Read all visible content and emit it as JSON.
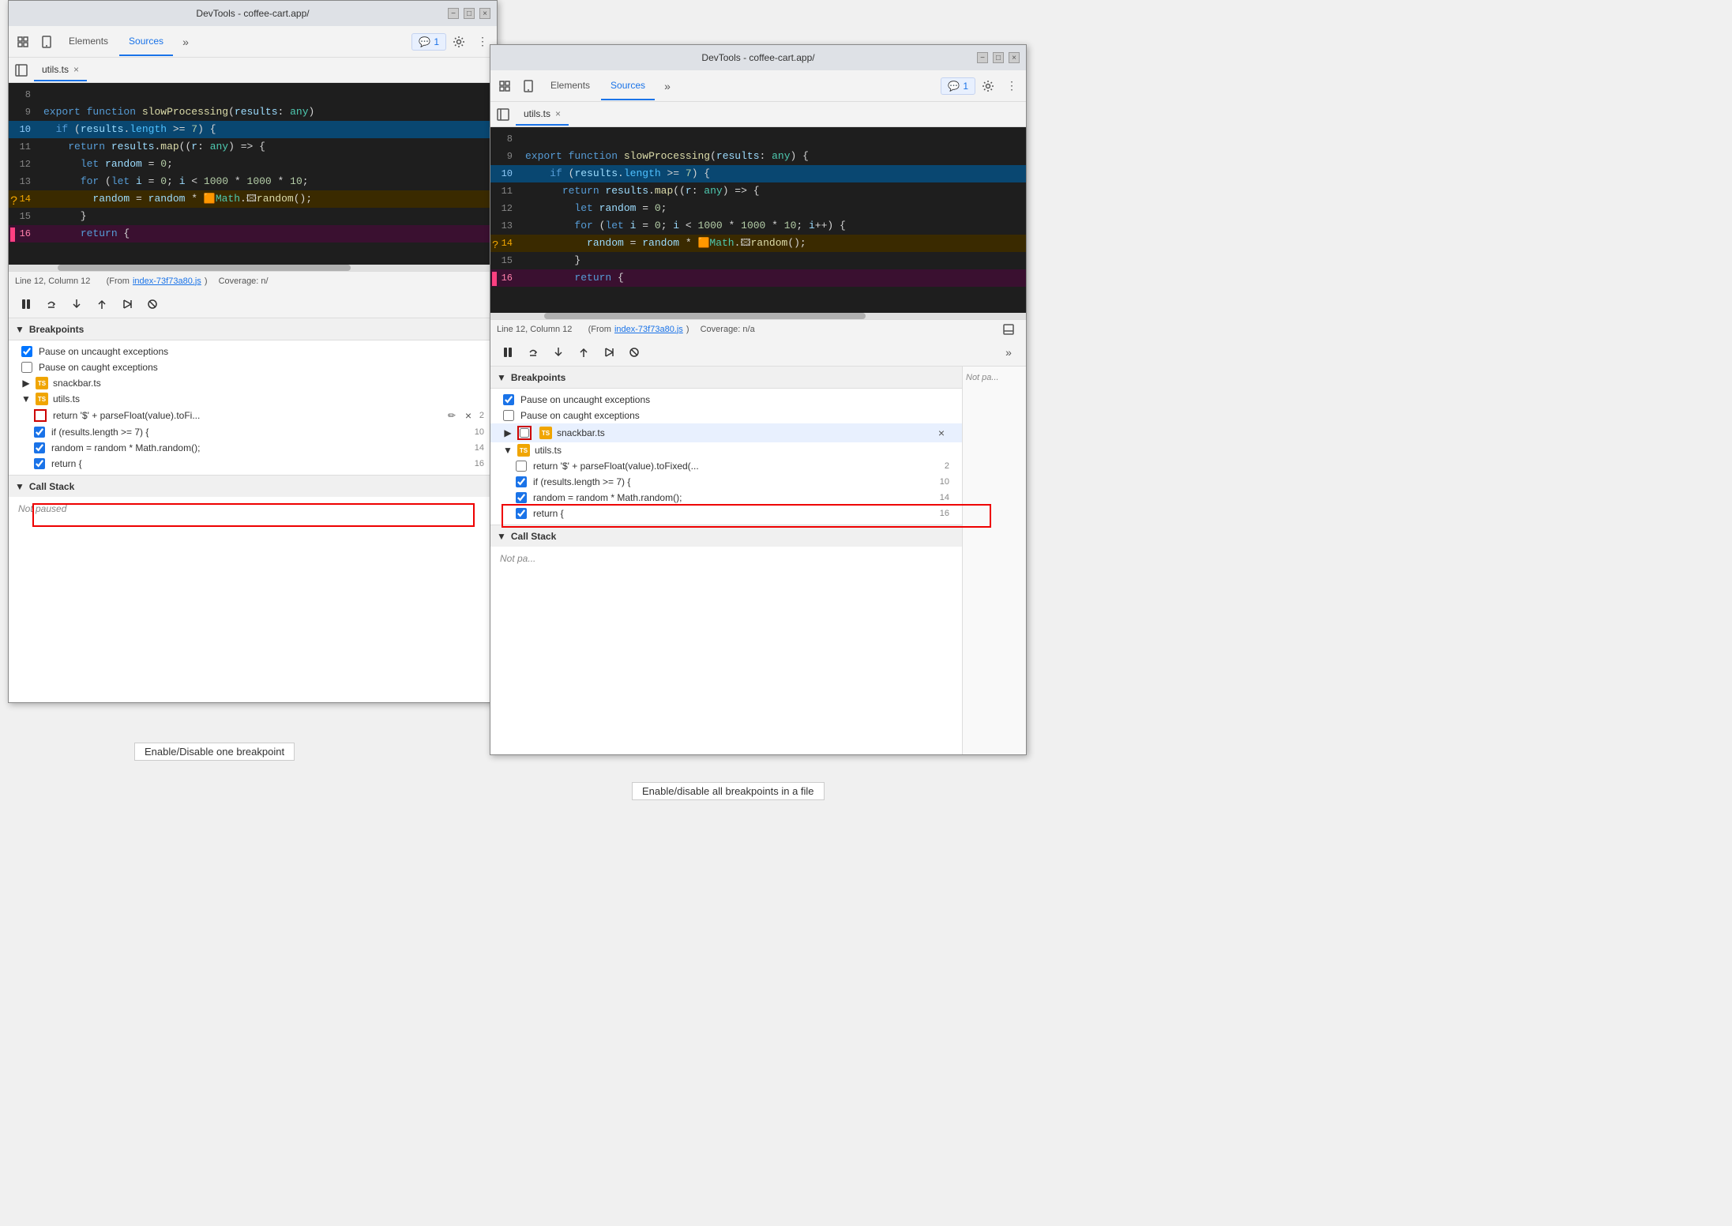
{
  "window1": {
    "title": "DevTools - coffee-cart.app/",
    "tabs": [
      "Elements",
      "Sources"
    ],
    "active_tab": "Sources",
    "file_tab": "utils.ts",
    "badge_label": "1",
    "code_lines": [
      {
        "num": 8,
        "content": "",
        "highlight": false,
        "breakpoint": false
      },
      {
        "num": 9,
        "content": "export function slowProcessing(results: any)",
        "highlight": false,
        "breakpoint": false
      },
      {
        "num": 10,
        "content": "  if (results.length >= 7) {",
        "highlight": true,
        "breakpoint": false
      },
      {
        "num": 11,
        "content": "    return results.map((r: any) => {",
        "highlight": false,
        "breakpoint": false
      },
      {
        "num": 12,
        "content": "      let random = 0;",
        "highlight": false,
        "breakpoint": false
      },
      {
        "num": 13,
        "content": "      for (let i = 0; i < 1000 * 1000 * 10;",
        "highlight": false,
        "breakpoint": false
      },
      {
        "num": 14,
        "content": "        random = random * 🟧Math.🖾random();",
        "highlight": false,
        "breakpoint": true
      },
      {
        "num": 15,
        "content": "      }",
        "highlight": false,
        "breakpoint": false
      },
      {
        "num": 16,
        "content": "      return {",
        "highlight": false,
        "breakpoint": "pink"
      }
    ],
    "status_line": "Line 12, Column 12",
    "status_file": "(From index-73f73a80.js)",
    "status_coverage": "Coverage: n/",
    "debug_btns": [
      "pause",
      "step-over",
      "step-into",
      "step-out",
      "continue",
      "deactivate"
    ],
    "breakpoints_section": "Breakpoints",
    "pause_uncaught": true,
    "pause_caught": false,
    "bp_files": [
      {
        "name": "snackbar.ts",
        "items": []
      },
      {
        "name": "utils.ts",
        "items": [
          {
            "text": "return '$' + parseFloat(value).toFi...",
            "checked": false,
            "line": 2,
            "red_outline": true
          },
          {
            "text": "if (results.length >= 7) {",
            "checked": true,
            "line": 10
          },
          {
            "text": "random = random * Math.random();",
            "checked": true,
            "line": 14
          },
          {
            "text": "return {",
            "checked": true,
            "line": 16
          }
        ]
      }
    ],
    "call_stack_label": "Call Stack",
    "not_paused_label": "Not paused"
  },
  "window2": {
    "title": "DevTools - coffee-cart.app/",
    "tabs": [
      "Elements",
      "Sources"
    ],
    "active_tab": "Sources",
    "file_tab": "utils.ts",
    "badge_label": "1",
    "code_lines": [
      {
        "num": 8,
        "content": "",
        "highlight": false,
        "breakpoint": false
      },
      {
        "num": 9,
        "content": "export function slowProcessing(results: any) {",
        "highlight": false,
        "breakpoint": false
      },
      {
        "num": 10,
        "content": "  if (results.length >= 7) {",
        "highlight": true,
        "breakpoint": false
      },
      {
        "num": 11,
        "content": "    return results.map((r: any) => {",
        "highlight": false,
        "breakpoint": false
      },
      {
        "num": 12,
        "content": "      let random = 0;",
        "highlight": false,
        "breakpoint": false
      },
      {
        "num": 13,
        "content": "      for (let i = 0; i < 1000 * 1000 * 10; i++) {",
        "highlight": false,
        "breakpoint": false
      },
      {
        "num": 14,
        "content": "        random = random * 🟧Math.🖾random();",
        "highlight": false,
        "breakpoint": true
      },
      {
        "num": 15,
        "content": "      }",
        "highlight": false,
        "breakpoint": false
      },
      {
        "num": 16,
        "content": "      return {",
        "highlight": false,
        "breakpoint": "pink"
      }
    ],
    "status_line": "Line 12, Column 12",
    "status_file": "(From index-73f73a80.js)",
    "status_coverage": "Coverage: n/a",
    "debug_btns": [
      "pause",
      "step-over",
      "step-into",
      "step-out",
      "continue",
      "deactivate"
    ],
    "breakpoints_section": "Breakpoints",
    "pause_uncaught": true,
    "pause_caught": false,
    "bp_files": [
      {
        "name": "snackbar.ts",
        "highlighted": true,
        "items": []
      },
      {
        "name": "utils.ts",
        "items": [
          {
            "text": "return '$' + parseFloat(value).toFixed(...",
            "checked": false,
            "line": 2
          },
          {
            "text": "if (results.length >= 7) {",
            "checked": true,
            "line": 10
          },
          {
            "text": "random = random * Math.random();",
            "checked": true,
            "line": 14
          },
          {
            "text": "return {",
            "checked": true,
            "line": 16
          }
        ]
      }
    ],
    "call_stack_label": "Call Stack",
    "not_paused_label": "Not pa..."
  },
  "annotation1": {
    "label": "Enable/Disable one breakpoint"
  },
  "annotation2": {
    "label": "Enable/disable all breakpoints in a file"
  },
  "icons": {
    "inspect": "⬚",
    "device": "⬒",
    "elements": "Elements",
    "sources": "Sources",
    "more": "»",
    "settings": "⚙",
    "menu": "⋮",
    "chat": "💬",
    "sidebar": "◧",
    "close": "×",
    "pause": "⏸",
    "step_over": "↻",
    "step_into": "↓",
    "step_out": "↑",
    "continue": "→→",
    "deactivate": "⊘",
    "collapse_arrow_down": "▼",
    "collapse_arrow_right": "▶",
    "expand_more": "»"
  }
}
